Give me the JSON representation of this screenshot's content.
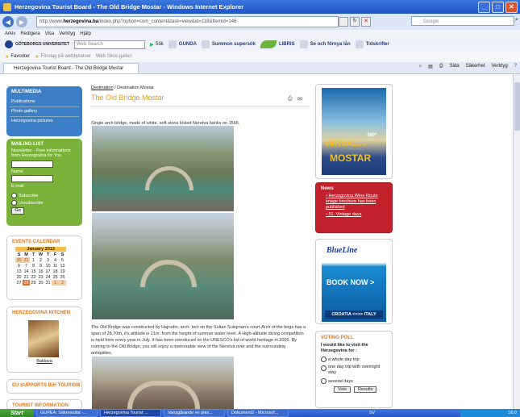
{
  "window": {
    "title": "Herzegovina Tourist Board - The Old Bridge Mostar - Windows Internet Explorer"
  },
  "addressbar": {
    "url_prefix": "http://www.",
    "url_domain": "herzegovina.ba",
    "url_rest": "/index.php?option=com_content&task=view&id=118&Itemid=146",
    "search_placeholder": "Google"
  },
  "menu": [
    "Arkiv",
    "Redigera",
    "Visa",
    "Verktyg",
    "Hjälp"
  ],
  "toolbar": {
    "university": "GÖTEBORGS UNIVERSITET",
    "search_placeholder": "Web Search",
    "sok": "Sök",
    "items": [
      "GUNDA",
      "Summon supersök",
      "LIBRIS",
      "Se och förnya lån",
      "Tidskrifter"
    ]
  },
  "favorites": {
    "label": "Favoriter",
    "items": [
      "Förslag på webbplatser",
      "Web Slice-galleri"
    ]
  },
  "tab": {
    "title": "Herzegovina Tourist Board - The Old Bridge Mostar",
    "tools": [
      "Sida",
      "Säkerhet",
      "Verktyg"
    ]
  },
  "sidebar": {
    "multimedia": {
      "title": "MULTIMEDIA",
      "items": [
        "Publications",
        "Photo gallery",
        "Herzegovina pictures"
      ]
    },
    "mailing": {
      "title": "MAILING LIST",
      "desc": "Newsletter - Free informations from Herzegovina for You",
      "name_label": "Name",
      "email_label": "E-mail",
      "subscribe": "Subscribe",
      "unsubscribe": "Unsubscribe",
      "go": "Go"
    },
    "events": {
      "title": "EVENTS CALENDAR",
      "month": "January 2013",
      "weekdays": [
        "S",
        "M",
        "T",
        "W",
        "T",
        "F",
        "S"
      ],
      "weeks": [
        [
          "30",
          "31",
          "1",
          "2",
          "3",
          "4",
          "5"
        ],
        [
          "6",
          "7",
          "8",
          "9",
          "10",
          "11",
          "12"
        ],
        [
          "13",
          "14",
          "15",
          "16",
          "17",
          "18",
          "19"
        ],
        [
          "20",
          "21",
          "22",
          "23",
          "24",
          "25",
          "26"
        ],
        [
          "27",
          "28",
          "29",
          "30",
          "31",
          "1",
          "2"
        ]
      ]
    },
    "kitchen": {
      "title": "HERZEGOVINA KITCHEN",
      "caption": "Baklava"
    },
    "eu": {
      "title": "EU SUPPORTS BiH TOURISM"
    },
    "tourist_info": {
      "title": "TOURIST INFORMATION"
    }
  },
  "main": {
    "breadcrumb": [
      "Destination",
      "Destination Mostar"
    ],
    "title": "The Old Bridge Mostar",
    "intro": "Single arch bridge, made of white, soft stone linked Neretva banks on 1566.",
    "body": "The Old Bridge was constructed by Hajrudin, arch- tect on the Sultan Sulejman's court.Arch of the brigs has a span of 28,70m, it's altitude is 21m. from the height of summer water level. A High-altitude diving competition is held here every year in July. It has been introduced on the UNESCO's list of world heritage in 2005. By coming to the Old Bridge, you will enjoy a memorable view of the Neretva river and the surrounding antiquities."
  },
  "right": {
    "ad1": {
      "virtual": "VIRTUAL",
      "tour": "tour",
      "deg": "360°",
      "city": "MOSTAR"
    },
    "news": {
      "title": "News",
      "items": [
        "Herzegovina Wine Route image brochure has been published",
        "51. Vintage days"
      ]
    },
    "ad2": {
      "brand": "BlueLine",
      "cta": "BOOK NOW >",
      "route": "CROATIA <<>> ITALY"
    },
    "poll": {
      "title": "VOTING POLL",
      "question": "I would like to visit the Herzegovina for :",
      "options": [
        "a whole day trip",
        "one day trip with overnight stay",
        "several days"
      ],
      "vote": "Vote",
      "results": "Results"
    }
  },
  "taskbar": {
    "start": "Start",
    "tasks": [
      "GUPEA: Sökresultat -...",
      "Herzegovina Tourist ...",
      "Vanzgårande ev ples...",
      "Dokument2 - Microsof..."
    ],
    "lang": "SV",
    "time": "16:0"
  }
}
